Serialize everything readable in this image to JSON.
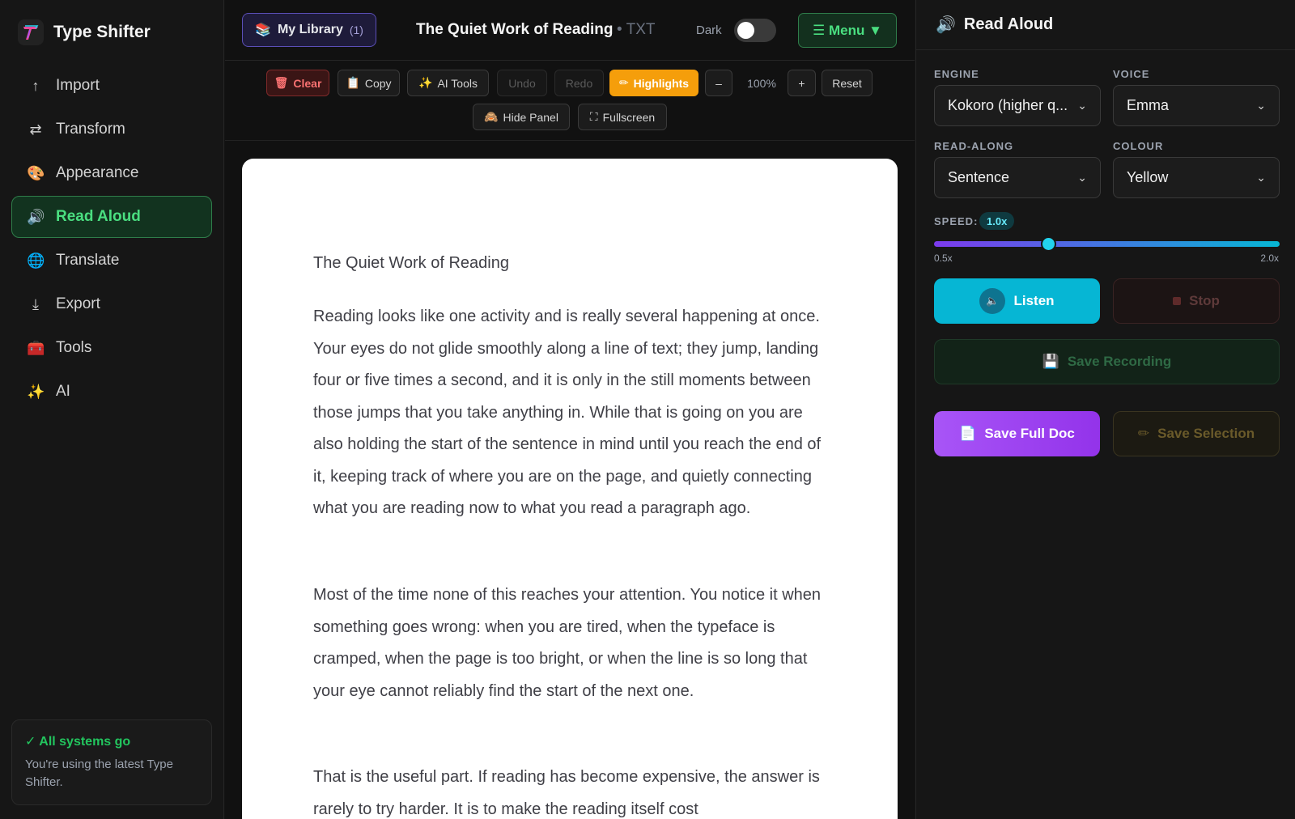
{
  "app": {
    "name": "Type Shifter"
  },
  "sidebar": {
    "items": [
      {
        "label": "Import",
        "icon": "arrow-up-icon",
        "glyph": "↑"
      },
      {
        "label": "Transform",
        "icon": "swap-icon",
        "glyph": "⇄"
      },
      {
        "label": "Appearance",
        "icon": "palette-icon",
        "glyph": "🎨"
      },
      {
        "label": "Read Aloud",
        "icon": "speaker-icon",
        "glyph": "🔊",
        "active": true
      },
      {
        "label": "Translate",
        "icon": "globe-icon",
        "glyph": "🌐"
      },
      {
        "label": "Export",
        "icon": "arrow-down-icon",
        "glyph": "⤓"
      },
      {
        "label": "Tools",
        "icon": "toolbox-icon",
        "glyph": "🧰"
      },
      {
        "label": "AI",
        "icon": "sparkles-icon",
        "glyph": "✨"
      }
    ],
    "status": {
      "title": "✓ All systems go",
      "message": "You're using the latest Type Shifter."
    }
  },
  "header": {
    "library_label": "My Library",
    "library_count": "(1)",
    "doc_title": "The Quiet Work of Reading",
    "doc_type": "• TXT",
    "dark_label": "Dark",
    "dark_enabled": false,
    "menu_label": "☰ Menu ▼"
  },
  "toolbar": {
    "clear": "Clear",
    "copy": "Copy",
    "ai_tools": "AI Tools",
    "undo": "Undo",
    "redo": "Redo",
    "highlights": "Highlights",
    "zoom_out": "–",
    "zoom": "100%",
    "zoom_in": "+",
    "reset": "Reset",
    "hide_panel": "Hide Panel",
    "fullscreen": "Fullscreen"
  },
  "document": {
    "title": "The Quiet Work of Reading",
    "paragraphs": [
      "Reading looks like one activity and is really several happening at once. Your eyes do not glide smoothly along a line of text; they jump, landing four or five times a second, and it is only in the still moments between those jumps that you take anything in. While that is going on you are also holding the start of the sentence in mind until you reach the end of it, keeping track of where you are on the page, and quietly connecting what you are reading now to what you read a paragraph ago.",
      "Most of the time none of this reaches your attention. You notice it when something goes wrong: when you are tired, when the typeface is cramped, when the page is too bright, or when the line is so long that your eye cannot reliably find the start of the next one.",
      "That is the useful part. If reading has become expensive, the answer is rarely to try harder. It is to make the reading itself cost"
    ]
  },
  "panel": {
    "title": "Read Aloud",
    "engine_label": "ENGINE",
    "engine_value": "Kokoro (higher q...",
    "voice_label": "VOICE",
    "voice_value": "Emma",
    "readalong_label": "READ-ALONG",
    "readalong_value": "Sentence",
    "colour_label": "COLOUR",
    "colour_value": "Yellow",
    "speed_label": "SPEED:",
    "speed_value": "1.0x",
    "speed_min": "0.5x",
    "speed_max": "2.0x",
    "speed_fraction": 0.33,
    "listen": "Listen",
    "stop": "Stop",
    "save_recording": "Save Recording",
    "save_full": "Save Full Doc",
    "save_selection": "Save Selection"
  },
  "colors": {
    "accent_green": "#4ade80",
    "accent_cyan": "#06b6d4",
    "accent_purple": "#a855f7",
    "highlight": "#f59e0b"
  }
}
